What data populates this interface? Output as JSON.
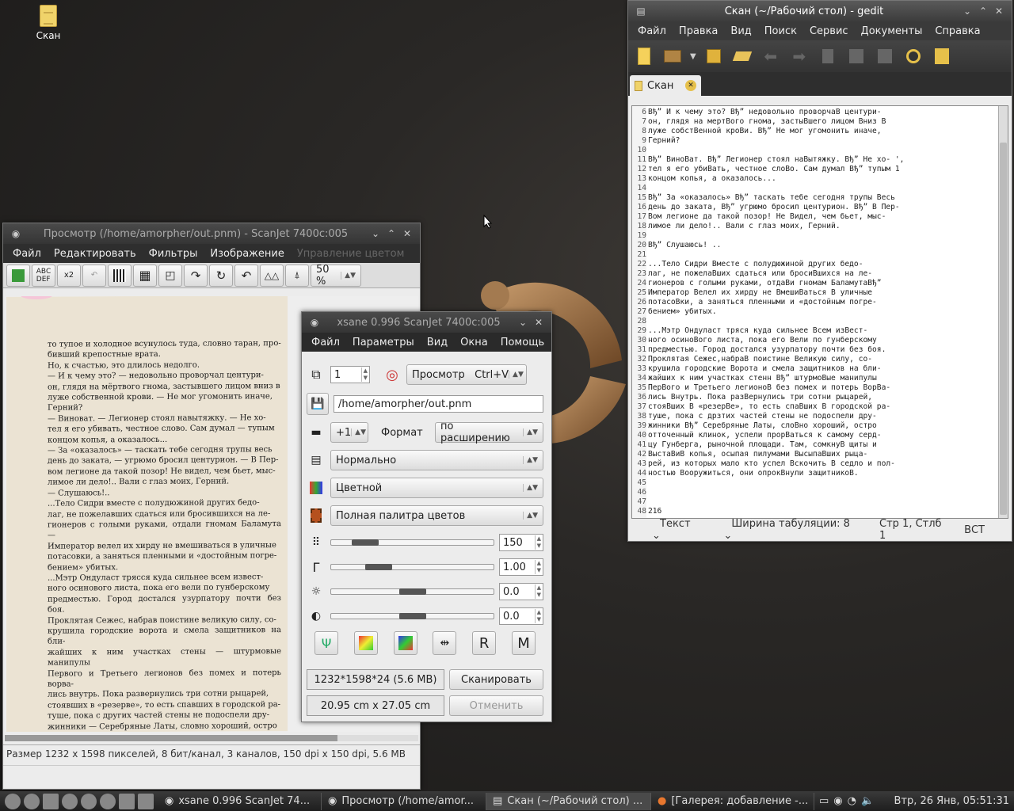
{
  "desktop": {
    "icon_label": "Скан"
  },
  "gedit": {
    "title": "Скан (~/Рабочий стол) - gedit",
    "menu": [
      "Файл",
      "Правка",
      "Вид",
      "Поиск",
      "Сервис",
      "Документы",
      "Справка"
    ],
    "tab_label": "Скан",
    "line_numbers": "6\n7\n8\n9\n10\n11\n12\n13\n14\n15\n16\n17\n18\n19\n20\n21\n22\n23\n24\n25\n26\n27\n28\n29\n30\n31\n32\n33\n34\n35\n36\n37\n38\n39\n40\n41\n42\n43\n44\n45\n46\n47\n48",
    "text": "Вђ” И к чему это? Вђ” недовольно проворчаВ центури-\nон, глядя на мертВого гнома, застыВшего лицом Вниз В\nлуже собстВенной кроВи. Вђ” Не мог угомонить иначе,\nГерний?\n\nВђ” ВиноВат. Вђ” Легионер стоял наВытяжку. Вђ” Не хо- ',\nтел я его убиВать, честное слоВо. Сам думал Вђ” тупым 1\nконцом копья, а оказалось...\n\nВђ” За «оказалось» Вђ” таскать тебе сегодня трупы Весь\nдень до заката, Вђ” угрюмо бросил центурион. Вђ” В Пер-\nВом легионе да такой позор! Не Видел, чем бьет, мыс-\nлимое ли дело!.. Вали с глаз моих, Герний.\n\nВђ” Слушаюсь! ..\n\n...Тело Сидри Вместе с полудюжиной других бедо-\nлаг, не пожелаВших сдаться или бросиВшихся на ле-\nгионеров с голыми руками, отдаВи гномам БаламутаВђ”\nИмператор Велел их хирду не ВмешиВаться В уличные\nпотасоВки, а заняться пленными и «достойным погре-\nбением» убитых.\n\n...Мэтр Ондуласт тряся куда сильнее Всем изВест-\nного осиноВого листа, пока его Вели по гунберскому\nпредместью. Город достался узурпатору почти без боя.\nПроклятая Сежес,набраВ поистине Великую силу, со-\nкрушила городские Ворота и смела защитников на бли-\nжайших к ним участках стенн Вђ” штурмоВые манипулы\nПерВого и Третьего легионоВ без помех и потерь ВорВа-\nлись Внутрь. Пока разВернулись три сотни рыцарей,\nстояВших В «резерВе», то есть спаВших В городской ра-\nтуше, пока с дрзтих частей стены не подоспели дру-\nжинники Вђ” Серебряные Латы, слоВно хороший, остро\nотточенный клинок, успели прорВаться к самому серд-\nцу Гунберга, рыночной площади. Там, сомкнуВ щиты и\nВыстаВиВ копья, осыпая пилумами ВысыпаВших рыца-\nрей, из которых мало кто успел Вскочить В седло и пол-\nностью Вооружиться, они опрокВнули защитникоВ.\n\n\n\n216",
    "status": {
      "mode": "Текст",
      "tab_width": "Ширина табуляции:  8",
      "position": "Стр 1, Стлб 1",
      "insert": "ВСТ"
    }
  },
  "preview": {
    "title": "Просмотр (/home/amorpher/out.pnm) - ScanJet 7400c:005",
    "menu": [
      "Файл",
      "Редактировать",
      "Фильтры",
      "Изображение",
      "Управление цветом"
    ],
    "zoom": "50 %",
    "ocr_label": "ABC\nDEF",
    "x2_label": "x2",
    "page_text": "то тупое и холодное всунулось туда, словно таран, про-\nбивший крепостные врата.\n    Но, к счастью, это длилось недолго.\n    — И к чему это? — недовольно проворчал центури-\nон, глядя на мёртвого гнома, застывшего лицом вниз в\nлуже собственной крови. — Не мог угомонить иначе,\nГерний?\n    — Виноват. — Легионер стоял навытяжку. — Не хо-\nтел я его убивать, честное слово. Сам думал — тупым\nконцом копья, а оказалось...\n    — За «оказалось» — таскать тебе сегодня трупы весь\nдень до заката, — угрюмо бросил центурион. — В Пер-\nвом легионе да такой позор! Не видел, чем бьет, мыс-\nлимое ли дело!.. Вали с глаз моих, Герний.\n    — Слушаюсь!..\n    ...Тело Сидри вместе с полудюжиной других бедо-\nлаг, не пожелавших сдаться или бросившихся на ле-\nгионеров с голыми руками, отдали гномам Баламута —\nИмператор велел их хирду не вмешиваться в уличные\nпотасовки, а заняться пленными и «достойным погре-\nбением» убитых.\n    ...Мэтр Ондуласт трясся куда сильнее всем извест-\nного осинового листа, пока его вели по гунберскому\nпредместью. Город достался узурпатору почти без боя.\nПроклятая Сежес, набрав поистине великую силу, со-\nкрушила городские ворота и смела защитников на бли-\nжайших к ним участках стены — штурмовые манипулы\nПервого и Третьего легионов без помех и потерь ворва-\nлись внутрь. Пока развернулись три сотни рыцарей,\nстоявших в «резерве», то есть спавших в городской ра-\nтуше, пока с других частей стены не подоспели дру-\nжинники — Серебряные Латы, словно хороший, остро\nотточенный клинок, успели прорваться к самому серд-\nцу Гунберга, рыночной площади. Там, сомкнув щиты и\nвыставив копья, осыпая пилумами высыпавших рыца-\nрей, из которых мало кто успел вскочить в седло и пол-\nностью вооружиться, они опрокинули защитников.",
    "status": "Размер 1232 x 1598 пикселей, 8 бит/канал, 3 каналов, 150 dpi x 150 dpi, 5.6 MB"
  },
  "xsane": {
    "title": "xsane 0.996 ScanJet 7400c:005",
    "menu": [
      "Файл",
      "Параметры",
      "Вид",
      "Окна",
      "Помощь"
    ],
    "copies": "1",
    "target": "Просмотр   Ctrl+V",
    "filename": "/home/amorpher/out.pnm",
    "step": "+1",
    "format_label": "Формат",
    "format_value": "по расширению",
    "scan_mode": "Нормально",
    "color_mode": "Цветной",
    "palette": "Полная палитра цветов",
    "resolution": "150",
    "gamma": "1.00",
    "brightness": "0.0",
    "contrast": "0.0",
    "sliders": {
      "resolution": 0.15,
      "gamma": 0.25,
      "brightness": 0.5,
      "contrast": 0.5
    },
    "size_info": "1232*1598*24 (5.6 MB)",
    "dimensions": "20.95 cm x 27.05 cm",
    "scan_button": "Сканировать",
    "cancel_button": "Отменить"
  },
  "taskbar": {
    "tasks": [
      "xsane 0.996 ScanJet 74...",
      "Просмотр (/home/amor...",
      "Скан (~/Рабочий стол) ...",
      "[Галерея: добавление -..."
    ],
    "clock": "Втр, 26 Янв, 05:51:31"
  }
}
